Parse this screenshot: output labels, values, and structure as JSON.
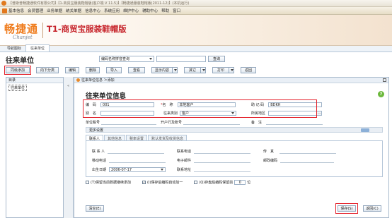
{
  "window": {
    "title": "【普斯普畅捷通软件有限公司】【1-商贸宝服装鞋帽版(客户端 V 11.5)】【畅捷通服装鞋帽版(2011-12)】(本机运行)"
  },
  "menu": [
    "基本信息",
    "会员管理",
    "业务单据",
    "统关单据",
    "信息中心",
    "系统应用",
    "维护中心",
    "辅助中心",
    "帮助",
    "窗口"
  ],
  "banner": {
    "logo": "畅捷通",
    "logo_sub": "Chanjet",
    "product": "T1-商贸宝服装鞋帽版"
  },
  "doc_tabs": [
    "导航图标",
    "往来单位"
  ],
  "page": {
    "title": "往来单位",
    "search_field": "编码名称拼音查询",
    "search_value": "",
    "search_button": "查询"
  },
  "toolbar": {
    "buttons": [
      "同级添加",
      "向下分类",
      "编辑",
      "删除",
      "导入",
      "查看",
      "显示内容",
      "其它",
      "打印",
      "返回"
    ]
  },
  "tree": {
    "header": "目录",
    "root": "往来单位"
  },
  "form": {
    "tab_label": "往来单位信息 ＞添加",
    "title": "往来单位信息",
    "help": "?",
    "code_label": "编　码",
    "code_value": "001",
    "name_label": "名　称",
    "name_value": "本地客户",
    "memo_code_label": "助 记 码",
    "memo_code_value": "BDKH",
    "alias_label": "别　名",
    "alias_value": "",
    "type_label": "往来类别",
    "type_value": "客户",
    "region_label": "所属地区",
    "region_value": "",
    "tax_label": "单位税号",
    "bank_label": "开户行及账号",
    "remark_label": "备　注",
    "more_settings": "更多设置",
    "sub_tabs": [
      "联系人",
      "其他信息",
      "税率设置",
      "默认发货及收货信息"
    ],
    "contact_label": "联 系 人",
    "phone_label": "联系电话",
    "fax_label": "传　真",
    "mobile_label": "移动电话",
    "email_label": "电子邮件",
    "postcode_label": "邮政编码",
    "birthday_label": "出生日期",
    "birthday_value": "2006-07-17",
    "address_label": "联系地址",
    "opt1": "(T)保留当前数据继续添加",
    "opt2": "(I)保存后编码自动加一",
    "opt3": "(Q)存盘后编码保留前",
    "opt3_value": "0",
    "opt3_unit": "位",
    "clear_button": "清空(E)",
    "save_button": "保存(S)",
    "back_button": "返回(C)"
  }
}
